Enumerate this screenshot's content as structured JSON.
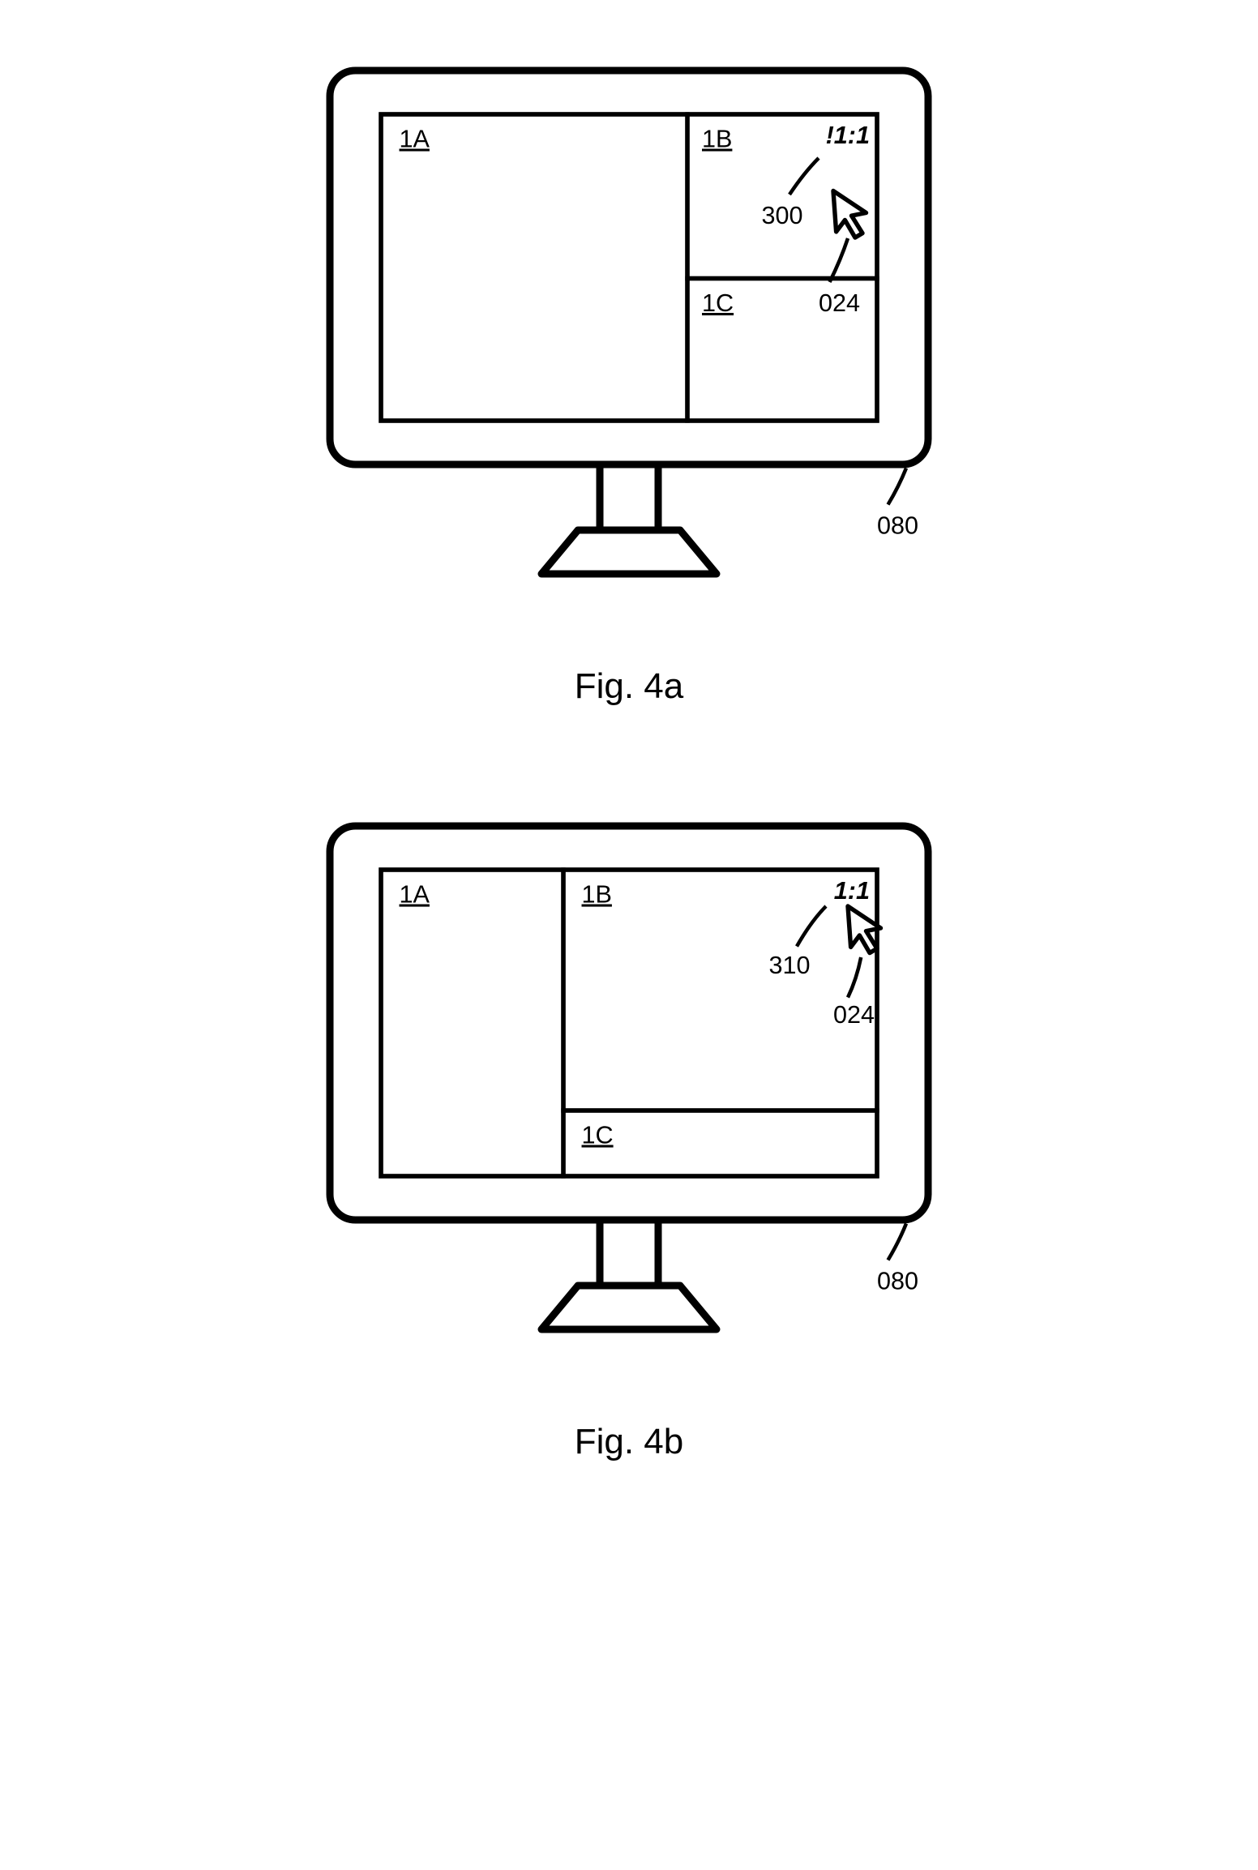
{
  "figures": {
    "a": {
      "caption": "Fig. 4a",
      "monitor_ref": "080",
      "cursor_ref": "024",
      "indicator_ref": "300",
      "indicator_text": "!1:1",
      "panes": {
        "a": "1A",
        "b": "1B",
        "c": "1C"
      }
    },
    "b": {
      "caption": "Fig. 4b",
      "monitor_ref": "080",
      "cursor_ref": "024",
      "indicator_ref": "310",
      "indicator_text": "1:1",
      "panes": {
        "a": "1A",
        "b": "1B",
        "c": "1C"
      }
    }
  }
}
